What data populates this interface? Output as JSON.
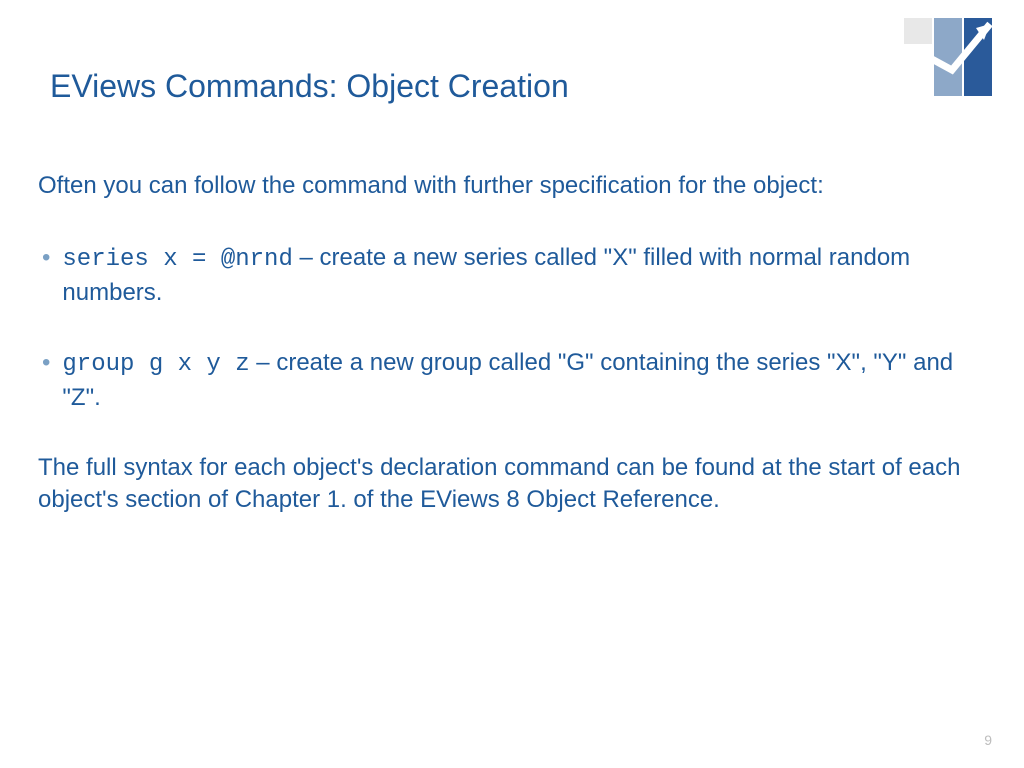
{
  "title": "EViews Commands: Object Creation",
  "intro": "Often you can follow the command with further specification for the object:",
  "bullets": [
    {
      "code": "series x = @nrnd",
      "sep": " – ",
      "desc": "create a new series called \"X\" filled with normal random numbers."
    },
    {
      "code": "group g x y z",
      "sep": " – ",
      "desc": "create a new group called \"G\" containing the series \"X\", \"Y\" and \"Z\"."
    }
  ],
  "footnote": "The full syntax for each object's declaration command can be found at the start of each object's section of Chapter 1. of the EViews 8 Object Reference.",
  "pagenum": "9",
  "bullet_char": "•"
}
